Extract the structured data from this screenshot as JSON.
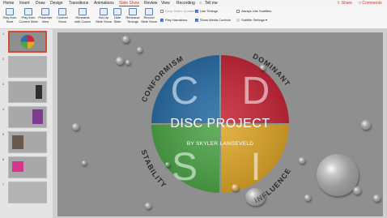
{
  "menu": {
    "items": [
      "Home",
      "Insert",
      "Draw",
      "Design",
      "Transitions",
      "Animations",
      "Slide Show",
      "Review",
      "View",
      "Recording"
    ],
    "tell_me": "Tell me",
    "share": "Share",
    "comments": "Comments"
  },
  "ribbon": {
    "buttons": [
      {
        "line1": "Play from",
        "line2": "Start"
      },
      {
        "line1": "Play from",
        "line2": "Current Slide"
      },
      {
        "line1": "Presenter",
        "line2": "View"
      },
      {
        "line1": "Custom",
        "line2": "Show"
      },
      {
        "line1": "Rehearse",
        "line2": "with Coach"
      },
      {
        "line1": "Set Up",
        "line2": "Slide Show"
      },
      {
        "line1": "Hide",
        "line2": "Slide"
      },
      {
        "line1": "Rehearse",
        "line2": "Timings"
      },
      {
        "line1": "Record",
        "line2": "Slide Show"
      }
    ],
    "options": {
      "keep_updated": "Keep Slides Updated",
      "play_narrations": "Play Narrations",
      "use_timings": "Use Timings",
      "show_media_controls": "Show Media Controls",
      "always_use_subtitles": "Always Use Subtitles",
      "subtitle_settings": "Subtitle Settings"
    }
  },
  "thumbnails": [
    "1",
    "2",
    "3",
    "4",
    "5",
    "6",
    "7"
  ],
  "slide": {
    "title": "DISC PROJECT",
    "subtitle": "BY SKYLER LANGEVELD",
    "letters": [
      "C",
      "D",
      "S",
      "I"
    ],
    "arc_labels": [
      "CONFORMISM",
      "DOMINANT",
      "STABILITY",
      "INFLUENCE"
    ],
    "colors": {
      "conformism": "#2b6fa8",
      "dominant": "#c8283a",
      "stability": "#4fa64a",
      "influence": "#e0a82a"
    }
  }
}
